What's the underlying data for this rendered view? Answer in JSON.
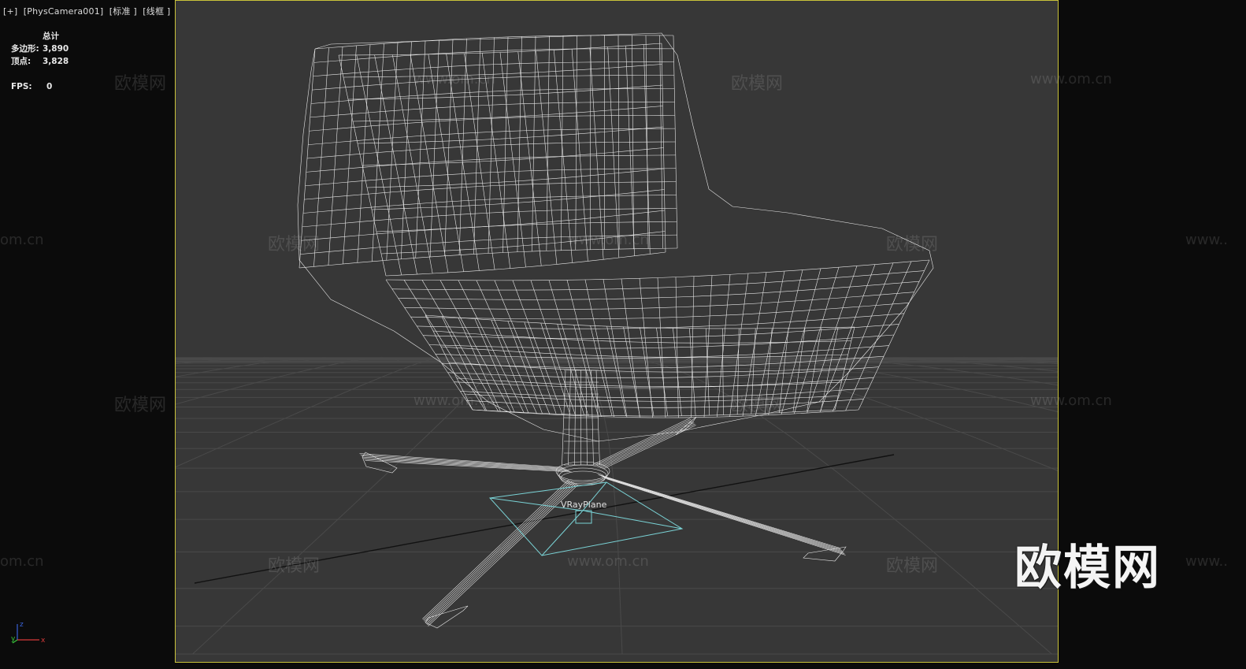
{
  "viewport": {
    "label": "[+]  [PhysCamera001]  [标准 ]  [线框 ]"
  },
  "stats": {
    "header": "总计",
    "polygons_label": "多边形:",
    "polygons_value": "3,890",
    "vertices_label": "顶点:",
    "vertices_value": "3,828",
    "fps_label": "FPS:",
    "fps_value": "0"
  },
  "scene": {
    "object_label": "VRayPlane"
  },
  "watermarks": {
    "brand": "欧模网",
    "url": "www.om.cn",
    "url_partial_left": "om.cn",
    "url_partial_right": "www..",
    "big_logo": "欧模网"
  },
  "axis": {
    "x": "x",
    "y": "y",
    "z": "z"
  },
  "colors": {
    "viewport_bg": "#373737",
    "frame_border": "#c9c23a",
    "wireframe": "#e8e8e8",
    "helper": "#7ad3d6"
  }
}
